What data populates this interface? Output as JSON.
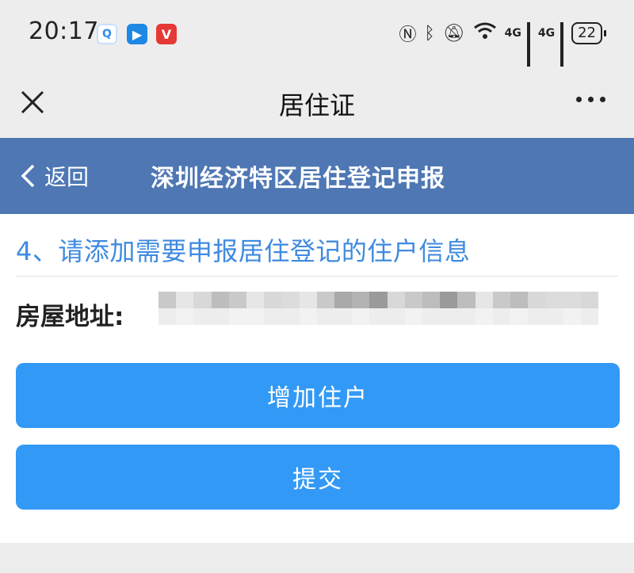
{
  "status_bar": {
    "time": "20:17",
    "battery": "22",
    "network_1": "4G",
    "network_2": "4G",
    "icons": [
      "chat-app-icon",
      "play-app-icon",
      "video-app-icon",
      "nfc-icon",
      "bluetooth-icon",
      "mute-icon",
      "wifi-icon",
      "signal-icon",
      "battery-icon"
    ]
  },
  "nav": {
    "title": "居住证",
    "close_icon": "close-icon",
    "more_icon": "more-icon"
  },
  "header": {
    "back_label": "返回",
    "title": "深圳经济特区居住登记申报"
  },
  "content": {
    "step_title": "4、请添加需要申报居住登记的住户信息",
    "address_label": "房屋地址:",
    "address_value_redacted": true,
    "add_button": "增加住户",
    "submit_button": "提交"
  },
  "colors": {
    "header_bg": "#4e77b4",
    "accent_text": "#3f8ae0",
    "button_bg": "#3399f6",
    "page_bg": "#ededed"
  }
}
